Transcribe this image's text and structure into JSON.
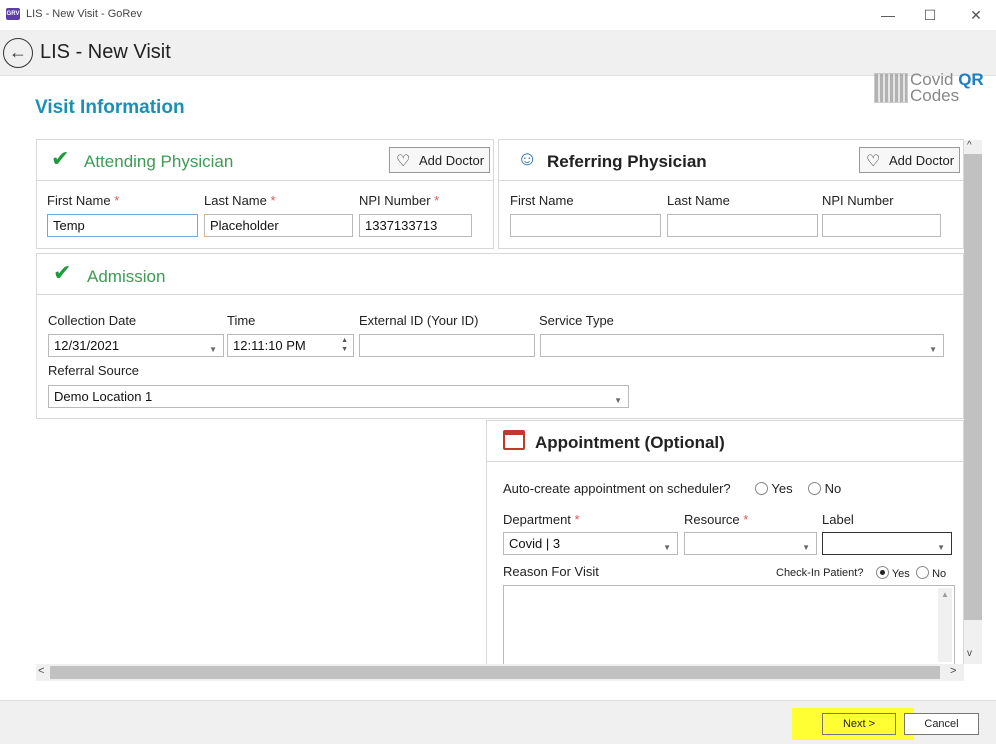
{
  "window": {
    "app_icon_text": "GRV",
    "title": "LIS - New Visit - GoRev",
    "minimize": "—",
    "maximize": "☐",
    "close": "✕"
  },
  "header": {
    "back_icon": "←",
    "title": "LIS - New Visit"
  },
  "logo": {
    "line1": "Covid",
    "line1_bold": "QR",
    "line2": "Codes"
  },
  "section_title": "Visit Information",
  "attending": {
    "title": "Attending Physician",
    "add_doctor": "Add Doctor",
    "first_name_label": "First Name",
    "last_name_label": "Last Name",
    "npi_label": "NPI Number",
    "required_mark": "*",
    "first_name": "Temp",
    "last_name": "Placeholder",
    "npi": "1337133713"
  },
  "referring": {
    "title": "Referring Physician",
    "add_doctor": "Add Doctor",
    "first_name_label": "First Name",
    "last_name_label": "Last Name",
    "npi_label": "NPI Number",
    "first_name": "",
    "last_name": "",
    "npi": ""
  },
  "admission": {
    "title": "Admission",
    "collection_date_label": "Collection Date",
    "collection_date": "12/31/2021",
    "time_label": "Time",
    "time": "12:11:10 PM",
    "external_id_label": "External ID (Your ID)",
    "external_id": "",
    "service_type_label": "Service Type",
    "service_type": "",
    "referral_source_label": "Referral Source",
    "referral_source": "Demo Location 1"
  },
  "appointment": {
    "title": "Appointment (Optional)",
    "auto_create_label": "Auto-create appointment on scheduler?",
    "yes": "Yes",
    "no": "No",
    "department_label": "Department",
    "department": "Covid | 3",
    "resource_label": "Resource",
    "resource": "",
    "label_label": "Label",
    "label": "",
    "reason_label": "Reason For Visit",
    "checkin_label": "Check-In Patient?",
    "checkin_yes": "Yes",
    "checkin_no": "No",
    "reason": ""
  },
  "footer": {
    "next": "Next >",
    "cancel": "Cancel"
  },
  "colors": {
    "accent": "#1a8fb8",
    "success": "#3d9b54",
    "highlight": "#ffff33"
  }
}
